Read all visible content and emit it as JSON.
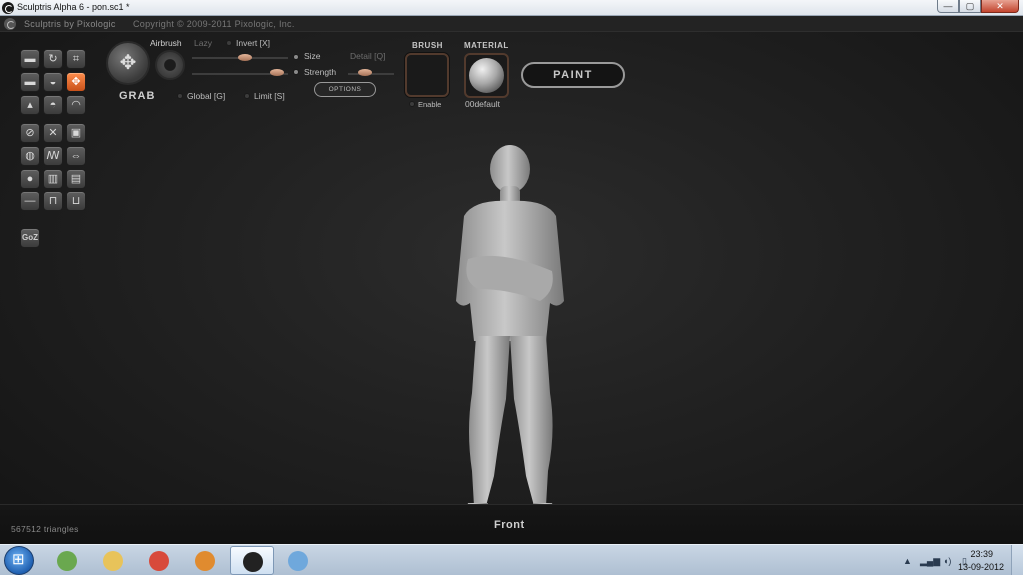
{
  "window": {
    "title": "Sculptris Alpha 6 - pon.sc1 *",
    "buttons": {
      "minimize": "—",
      "maximize": "▢",
      "close": "✕"
    }
  },
  "app_header": {
    "brand": "Sculptris by Pixologic",
    "copyright": "Copyright © 2009-2011 Pixologic, Inc."
  },
  "toolbar": {
    "grab_label": "GRAB",
    "airbrush_label": "Airbrush",
    "lazy_label": "Lazy",
    "invert_label": "Invert [X]",
    "size_label": "Size",
    "strength_label": "Strength",
    "detail_label": "Detail [Q]",
    "global_label": "Global [G]",
    "limit_label": "Limit [S]",
    "options_label": "OPTIONS",
    "brush_label": "BRUSH",
    "enable_label": "Enable",
    "material_label": "MATERIAL",
    "material_name": "00default",
    "paint_label": "PAINT",
    "goz_label": "GoZ"
  },
  "tools": [
    {
      "icon": "draw-icon",
      "glyph": "▬"
    },
    {
      "icon": "rotate-icon",
      "glyph": "↻"
    },
    {
      "icon": "crop-icon",
      "glyph": "⌗"
    },
    {
      "icon": "flatten-icon",
      "glyph": "▬"
    },
    {
      "icon": "inflate-icon",
      "glyph": "◒"
    },
    {
      "icon": "grab-tool-icon",
      "glyph": "✥",
      "active": true
    },
    {
      "icon": "pinch-icon",
      "glyph": "▴"
    },
    {
      "icon": "crease-icon",
      "glyph": "◓"
    },
    {
      "icon": "smooth-icon",
      "glyph": "◠"
    },
    {
      "icon": "reduce-brush-icon",
      "glyph": "⊘"
    },
    {
      "icon": "wire-icon",
      "glyph": "✕"
    },
    {
      "icon": "frame-icon",
      "glyph": "▣"
    },
    {
      "icon": "mask-icon",
      "glyph": "◍"
    },
    {
      "icon": "symmetry-icon",
      "glyph": "ꟿ"
    },
    {
      "icon": "mirror-icon",
      "glyph": "⇔"
    },
    {
      "icon": "sphere-icon",
      "glyph": "●"
    },
    {
      "icon": "load-icon",
      "glyph": "▥"
    },
    {
      "icon": "save-icon",
      "glyph": "▤"
    },
    {
      "icon": "plane-icon",
      "glyph": "—"
    },
    {
      "icon": "import-icon",
      "glyph": "⊓"
    },
    {
      "icon": "export-icon",
      "glyph": "⊔"
    }
  ],
  "status": {
    "triangles": "567512 triangles",
    "view": "Front"
  },
  "taskbar": {
    "apps": [
      {
        "name": "chrome-canary",
        "color": "#6aa84f"
      },
      {
        "name": "explorer",
        "color": "#e8c35a"
      },
      {
        "name": "chrome",
        "color": "#d84a3b"
      },
      {
        "name": "media-player",
        "color": "#e08b2f"
      },
      {
        "name": "sculptris",
        "color": "#222222",
        "active": true
      },
      {
        "name": "paint",
        "color": "#6fa8dc"
      }
    ],
    "time": "23:39",
    "date": "13-09-2012"
  },
  "colors": {
    "accent_tool": "#e8672c",
    "background": "#1f1f1f",
    "mesh": "#b9b9b9"
  }
}
